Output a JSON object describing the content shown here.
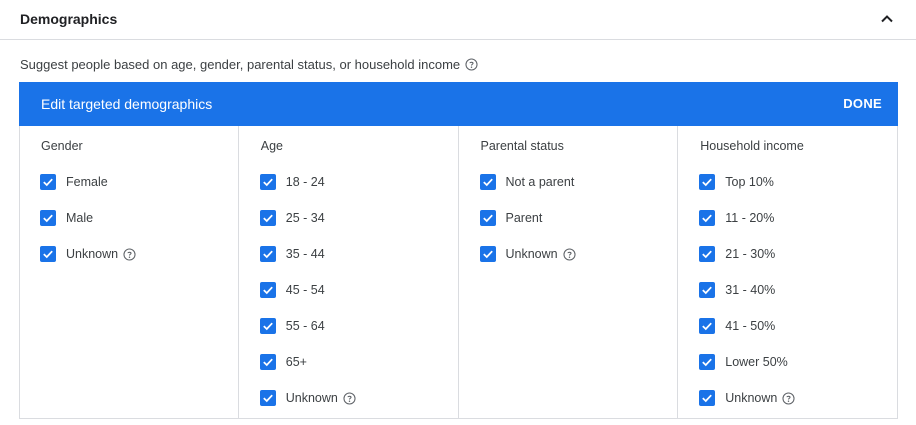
{
  "section": {
    "title": "Demographics"
  },
  "description": "Suggest people based on age, gender, parental status, or household income",
  "editor": {
    "title": "Edit targeted demographics",
    "done_label": "DONE"
  },
  "columns": [
    {
      "title": "Gender",
      "options": [
        {
          "label": "Female",
          "checked": true
        },
        {
          "label": "Male",
          "checked": true
        },
        {
          "label": "Unknown",
          "checked": true,
          "help": true
        }
      ]
    },
    {
      "title": "Age",
      "options": [
        {
          "label": "18 - 24",
          "checked": true
        },
        {
          "label": "25 - 34",
          "checked": true
        },
        {
          "label": "35 - 44",
          "checked": true
        },
        {
          "label": "45 - 54",
          "checked": true
        },
        {
          "label": "55 - 64",
          "checked": true
        },
        {
          "label": "65+",
          "checked": true
        },
        {
          "label": "Unknown",
          "checked": true,
          "help": true
        }
      ]
    },
    {
      "title": "Parental status",
      "options": [
        {
          "label": "Not a parent",
          "checked": true
        },
        {
          "label": "Parent",
          "checked": true
        },
        {
          "label": "Unknown",
          "checked": true,
          "help": true
        }
      ]
    },
    {
      "title": "Household income",
      "options": [
        {
          "label": "Top 10%",
          "checked": true
        },
        {
          "label": "11 - 20%",
          "checked": true
        },
        {
          "label": "21 - 30%",
          "checked": true
        },
        {
          "label": "31 - 40%",
          "checked": true
        },
        {
          "label": "41 - 50%",
          "checked": true
        },
        {
          "label": "Lower 50%",
          "checked": true
        },
        {
          "label": "Unknown",
          "checked": true,
          "help": true
        }
      ]
    }
  ],
  "colors": {
    "accent": "#1a73e8"
  },
  "icons": {
    "collapse": "chevron-up-icon",
    "help": "help-circle-icon",
    "checkbox": "checkbox-checked-icon"
  }
}
